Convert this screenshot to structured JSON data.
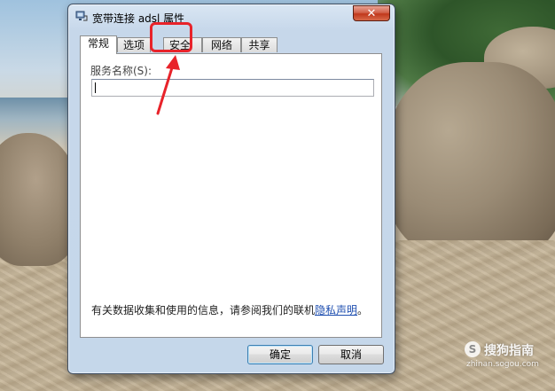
{
  "window": {
    "title": "宽带连接 adsl 属性",
    "close_label": "✕"
  },
  "tabs": [
    {
      "label": "常规",
      "active": true
    },
    {
      "label": "选项",
      "active": false
    },
    {
      "label": "安全",
      "active": false
    },
    {
      "label": "网络",
      "active": false
    },
    {
      "label": "共享",
      "active": false
    }
  ],
  "general": {
    "service_name_label": "服务名称(S):",
    "service_name_value": ""
  },
  "privacy": {
    "text": "有关数据收集和使用的信息，请参阅我们的联机",
    "link": "隐私声明",
    "suffix": "。"
  },
  "buttons": {
    "ok": "确定",
    "cancel": "取消"
  },
  "watermark": {
    "badge": "S",
    "name": "搜狗指南",
    "url": "zhinan.sogou.com"
  },
  "colors": {
    "annotation": "#e8232a",
    "close_button": "#c0381c",
    "link": "#1f4fb0"
  }
}
